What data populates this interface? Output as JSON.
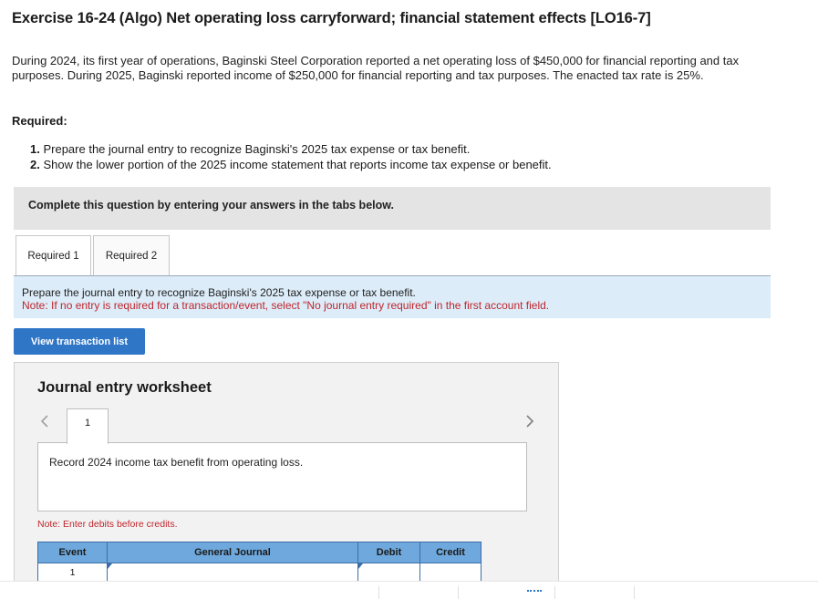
{
  "header": {
    "title": "Exercise 16-24 (Algo) Net operating loss carryforward; financial statement effects [LO16-7]",
    "intro": "During 2024, its first year of operations, Baginski Steel Corporation reported a net operating loss of $450,000 for financial reporting and tax purposes. During 2025, Baginski reported income of $250,000 for financial reporting and tax purposes. The enacted tax rate is 25%."
  },
  "required": {
    "label": "Required:",
    "items": [
      {
        "num": "1.",
        "text": "Prepare the journal entry to recognize Baginski's 2025 tax expense or tax benefit."
      },
      {
        "num": "2.",
        "text": "Show the lower portion of the 2025 income statement that reports income tax expense or benefit."
      }
    ]
  },
  "instruction": "Complete this question by entering your answers in the tabs below.",
  "tabs": [
    {
      "label": "Required 1"
    },
    {
      "label": "Required 2"
    }
  ],
  "prompt": {
    "line1": "Prepare the journal entry to recognize Baginski's 2025 tax expense or tax benefit.",
    "note": "Note: If no entry is required for a transaction/event, select \"No journal entry required\" in the first account field."
  },
  "view_button": "View transaction list",
  "worksheet": {
    "title": "Journal entry worksheet",
    "entry_tab": "1",
    "description": "Record 2024 income tax benefit from operating loss.",
    "note": "Note: Enter debits before credits.",
    "columns": [
      "Event",
      "General Journal",
      "Debit",
      "Credit"
    ],
    "rows": [
      {
        "event": "1",
        "account": "",
        "debit": "",
        "credit": ""
      }
    ]
  },
  "icons": {
    "prev": "chevron-left-icon",
    "next": "chevron-right-icon"
  },
  "colors": {
    "accent": "#2f76c7",
    "table_header": "#6fa8dc",
    "note_red": "#c0262d",
    "prompt_bg": "#dcecf8"
  }
}
